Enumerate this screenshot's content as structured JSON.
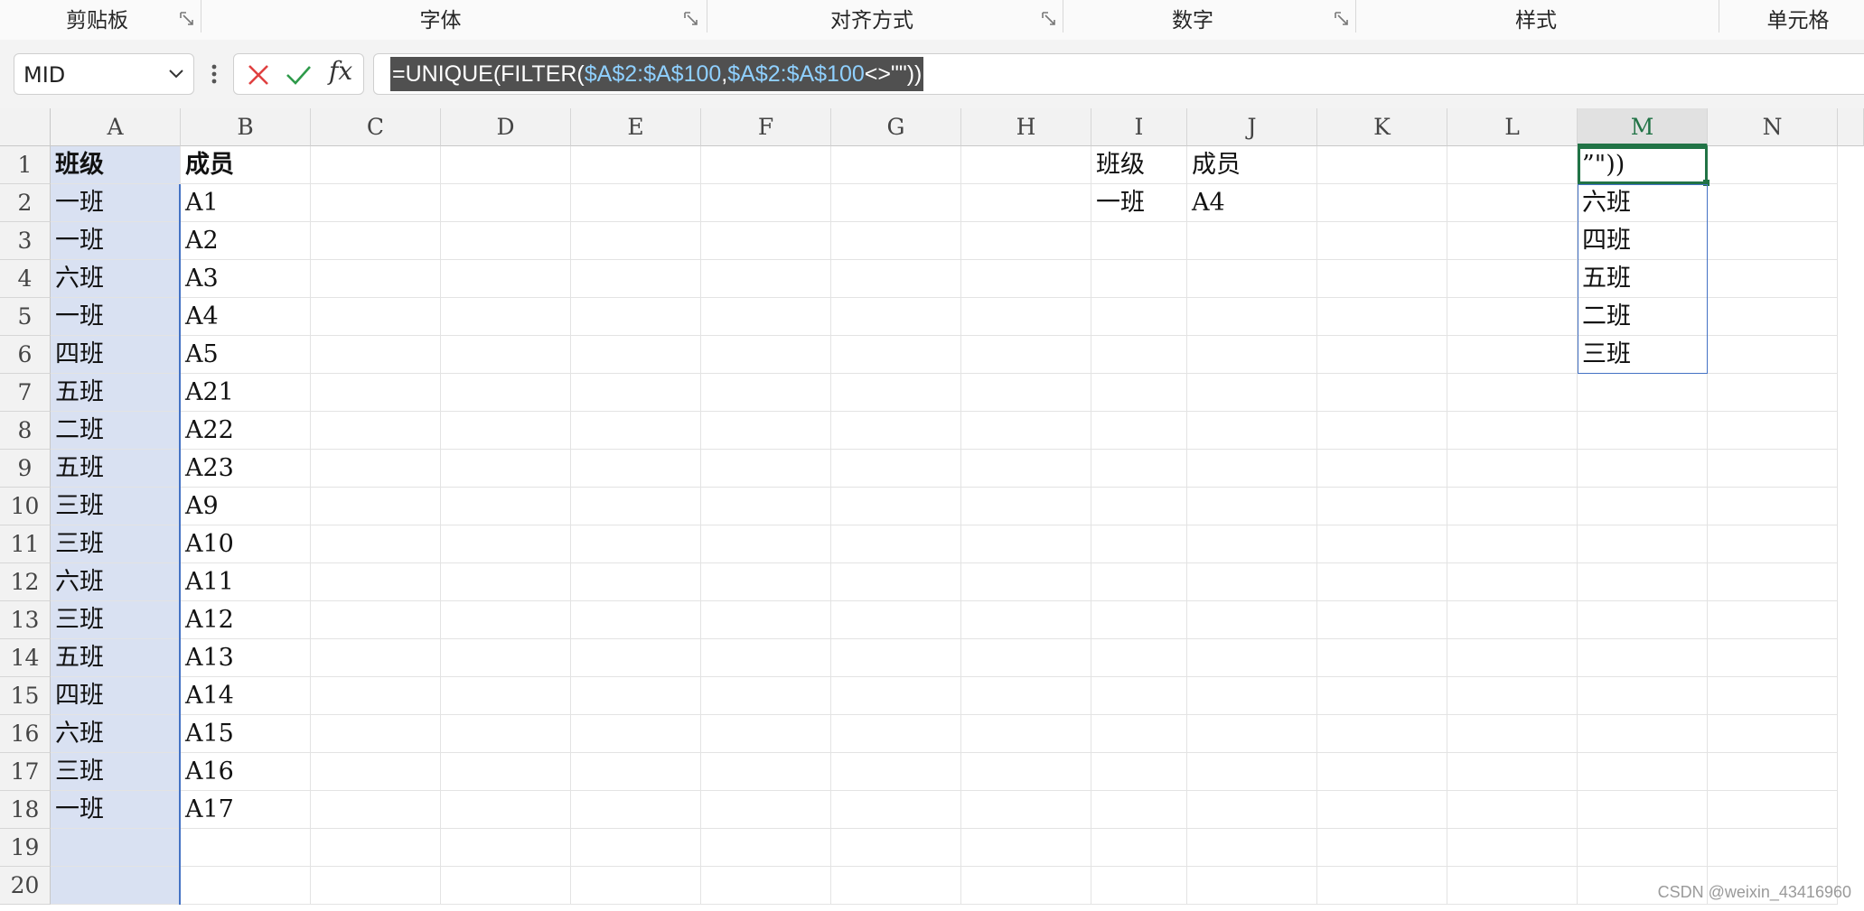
{
  "ribbon": {
    "groups": [
      {
        "label": "剪贴板",
        "launcher": "dialog-launcher-icon"
      },
      {
        "label": "字体",
        "launcher": "dialog-launcher-icon"
      },
      {
        "label": "对齐方式",
        "launcher": "dialog-launcher-icon"
      },
      {
        "label": "数字",
        "launcher": "dialog-launcher-icon"
      },
      {
        "label": "样式"
      },
      {
        "label": "单元格"
      }
    ]
  },
  "formula_bar": {
    "name_box": "MID",
    "cancel_icon": "x-icon",
    "enter_icon": "check-icon",
    "fx_label": "fx",
    "formula_parts": [
      {
        "text": "=UNIQUE(FILTER(",
        "kind": "plain"
      },
      {
        "text": "$A$2:$A$100",
        "kind": "ref"
      },
      {
        "text": ",",
        "kind": "plain"
      },
      {
        "text": "$A$2:$A$100",
        "kind": "ref"
      },
      {
        "text": "<>\"\"))",
        "kind": "plain"
      }
    ]
  },
  "sheet": {
    "columns": [
      "A",
      "B",
      "C",
      "D",
      "E",
      "F",
      "G",
      "H",
      "I",
      "J",
      "K",
      "L",
      "M",
      "N"
    ],
    "active_column": "M",
    "rows": [
      "1",
      "2",
      "3",
      "4",
      "5",
      "6",
      "7",
      "8",
      "9",
      "10",
      "11",
      "12",
      "13",
      "14",
      "15",
      "16",
      "17",
      "18",
      "19",
      "20"
    ],
    "cells": {
      "A": [
        "班级",
        "一班",
        "一班",
        "六班",
        "一班",
        "四班",
        "五班",
        "二班",
        "五班",
        "三班",
        "三班",
        "六班",
        "三班",
        "五班",
        "四班",
        "六班",
        "三班",
        "一班",
        "",
        ""
      ],
      "B": [
        "成员",
        "A1",
        "A2",
        "A3",
        "A4",
        "A5",
        "A21",
        "A22",
        "A23",
        "A9",
        "A10",
        "A11",
        "A12",
        "A13",
        "A14",
        "A15",
        "A16",
        "A17",
        "",
        ""
      ],
      "I": [
        "班级",
        "一班"
      ],
      "J": [
        "成员",
        "A4"
      ],
      "M": [
        "”\"))",
        "六班",
        "四班",
        "五班",
        "二班",
        "三班"
      ]
    }
  },
  "colors": {
    "accent_green": "#217346",
    "selection_fill": "#d9e1f2",
    "selection_border": "#4472c4",
    "formula_highlight": "#505050",
    "ref_color": "#8fd0ff"
  },
  "watermark": "CSDN @weixin_43416960"
}
